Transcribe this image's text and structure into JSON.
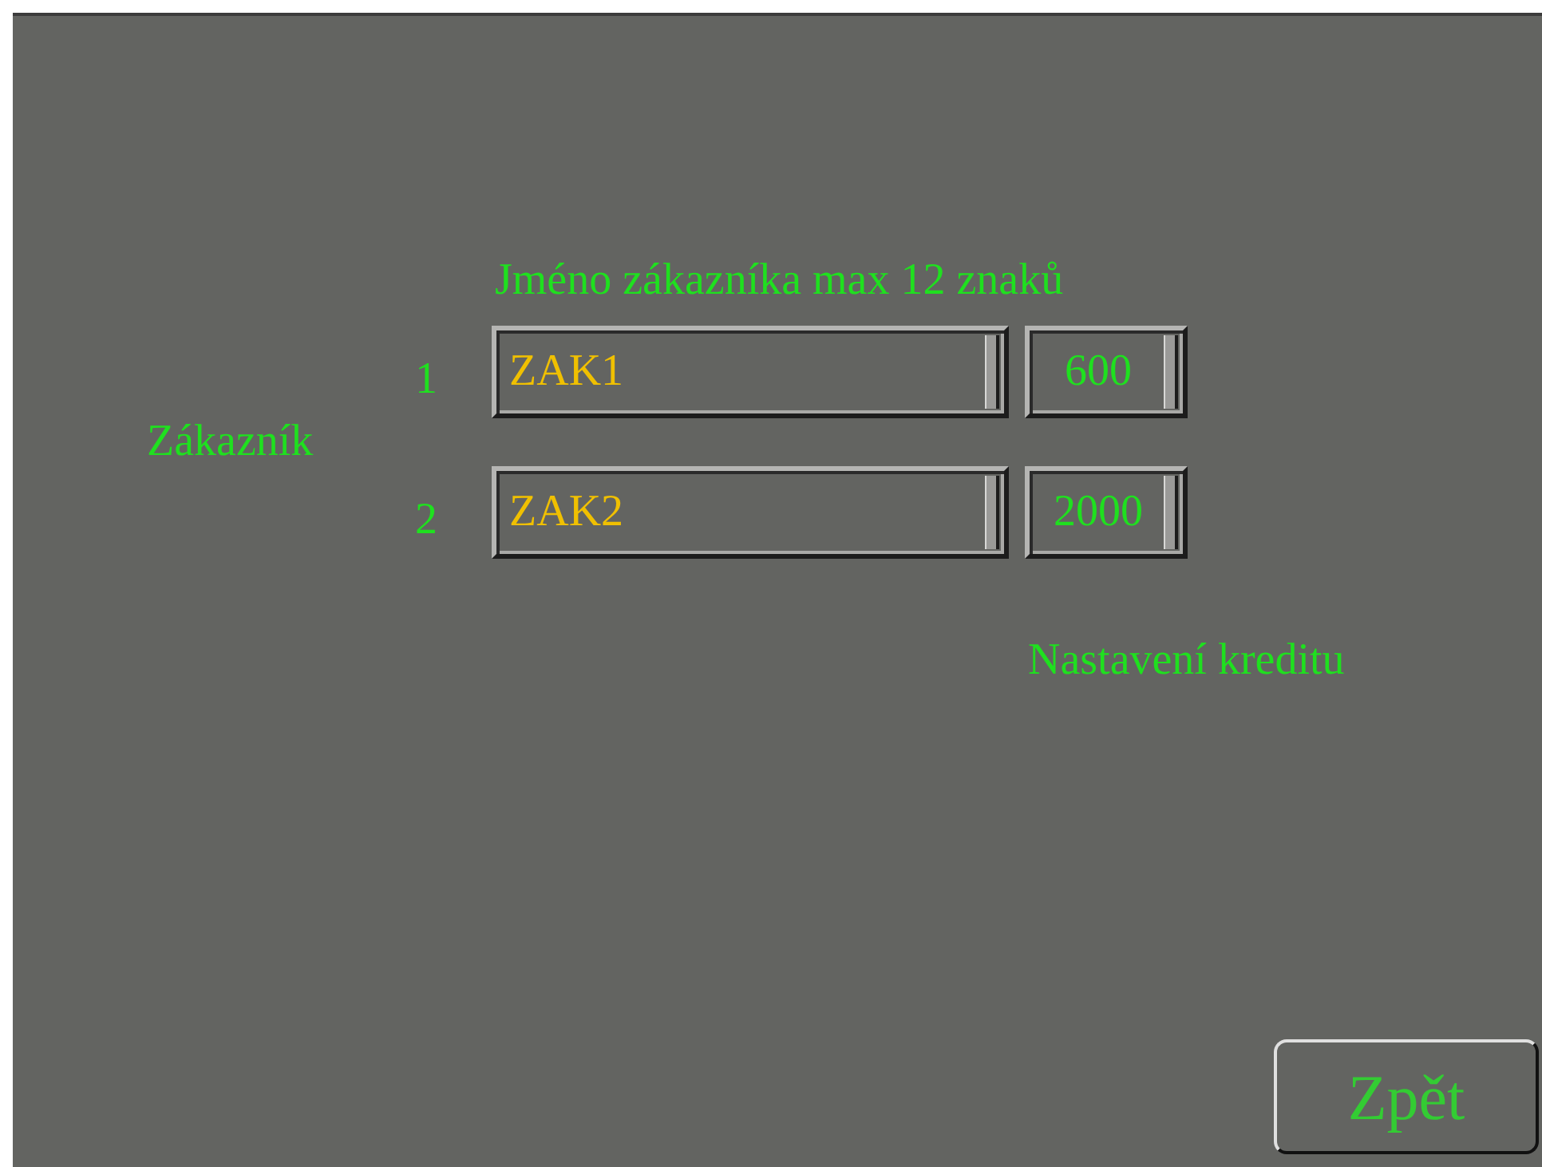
{
  "name_heading": "Jméno zákazníka max 12 znaků",
  "customer_label": "Zákazník",
  "customers": [
    {
      "number": "1",
      "name": "ZAK1",
      "credit": "600"
    },
    {
      "number": "2",
      "name": "ZAK2",
      "credit": "2000"
    }
  ],
  "credit_label": "Nastavení kreditu",
  "back_button": "Zpět"
}
